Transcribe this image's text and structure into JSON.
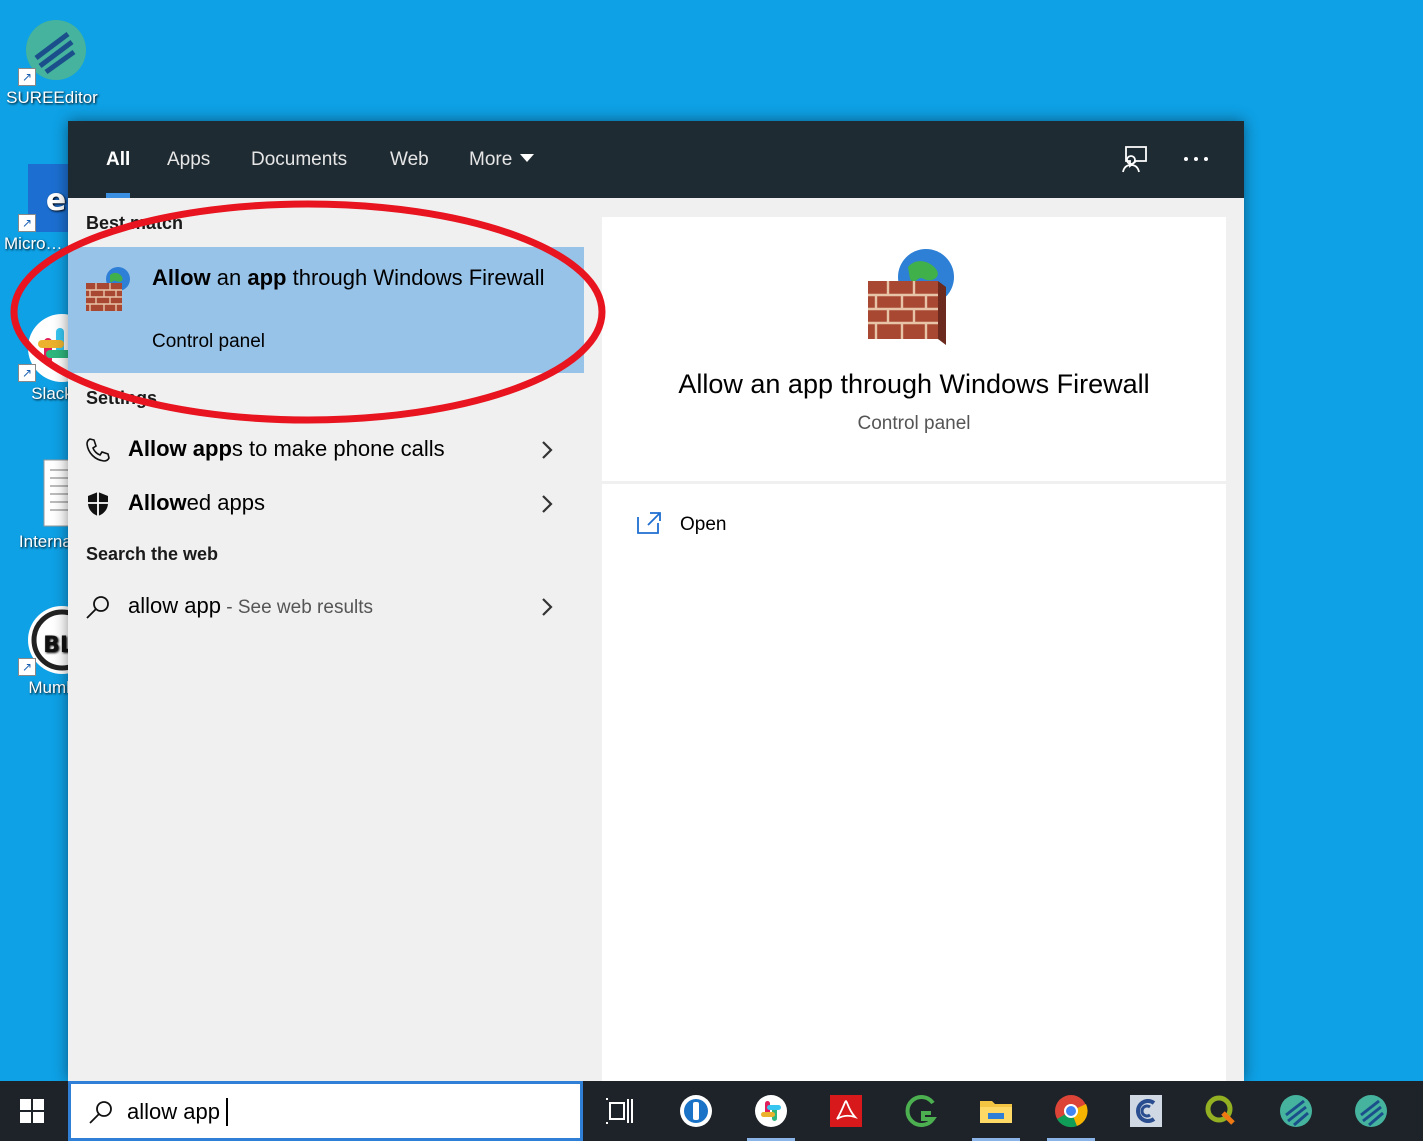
{
  "desktop": {
    "icons": [
      {
        "label": "SUREEditor",
        "icon": "sureeditor-icon"
      },
      {
        "label": "Micro… Edge",
        "icon": "edge-icon"
      },
      {
        "label": "Slack",
        "icon": "slack-icon"
      },
      {
        "label": "Internal_",
        "icon": "document-icon"
      },
      {
        "label": "Mumb",
        "icon": "mumble-icon"
      }
    ]
  },
  "search": {
    "tabs": [
      {
        "label": "All",
        "active": true
      },
      {
        "label": "Apps"
      },
      {
        "label": "Documents"
      },
      {
        "label": "Web"
      },
      {
        "label": "More"
      }
    ],
    "sections": {
      "best_match": "Best match",
      "settings": "Settings",
      "search_web": "Search the web"
    },
    "best_match": {
      "title_part1": "Allow",
      "title_part2": " an ",
      "title_part3": "app",
      "title_part4": " through Windows Firewall",
      "subtitle": "Control panel",
      "icon": "firewall-icon"
    },
    "settings_items": [
      {
        "bold": "Allow app",
        "rest": "s to make phone calls",
        "icon": "phone-icon"
      },
      {
        "bold": "Allow",
        "rest": "ed apps",
        "icon": "shield-icon"
      }
    ],
    "web_item": {
      "query": "allow app",
      "hint": " - See web results",
      "icon": "search-icon"
    },
    "preview": {
      "title": "Allow an app through Windows Firewall",
      "subtitle": "Control panel",
      "open_label": "Open"
    }
  },
  "taskbar": {
    "search_value": "allow app",
    "apps": [
      "task-view-icon",
      "1password-icon",
      "slack-icon",
      "acrobat-icon",
      "gimp-icon",
      "file-explorer-icon",
      "chrome-icon",
      "ccleaner-icon",
      "qgis-icon",
      "sureeditor-icon",
      "sureeditor-icon"
    ]
  },
  "colors": {
    "desktop": "#0ea1e6",
    "topbar": "#1f2b33",
    "highlight": "#98c3e8",
    "annotation": "#e8141f"
  }
}
